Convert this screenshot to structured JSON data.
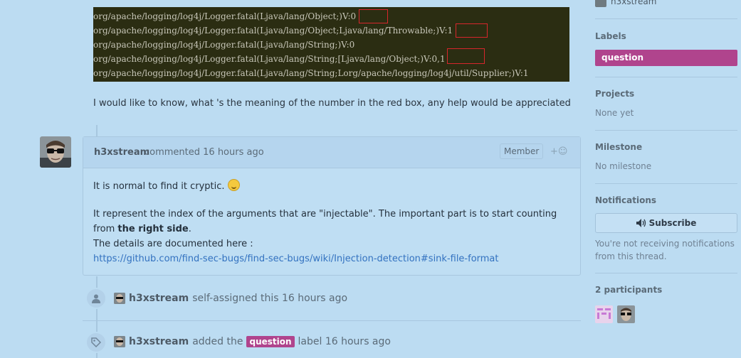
{
  "code": {
    "lines": [
      "org/apache/logging/log4j/Logger.fatal(Ljava/lang/Object;)V:0",
      "org/apache/logging/log4j/Logger.fatal(Ljava/lang/Object;Ljava/lang/Throwable;)V:1",
      "org/apache/logging/log4j/Logger.fatal(Ljava/lang/String;)V:0",
      "org/apache/logging/log4j/Logger.fatal(Ljava/lang/String;[Ljava/lang/Object;)V:0,1",
      "org/apache/logging/log4j/Logger.fatal(Ljava/lang/String;Lorg/apache/logging/log4j/util/Supplier;)V:1"
    ]
  },
  "question_text": "I would like to know, what 's the meaning of the number in the red box, any help would be appreciated",
  "comment": {
    "author": "h3xstream",
    "meta": "commented 16 hours ago",
    "badge": "Member",
    "reaction": "+☺",
    "p1": "It is normal to find it cryptic.",
    "p2_before": "It represent the index of the arguments that are \"injectable\". The important part is to start counting from ",
    "p2_bold": "the right side",
    "p2_after": ".",
    "p3": "The details are documented here :",
    "link": "https://github.com/find-sec-bugs/find-sec-bugs/wiki/Injection-detection#sink-file-format"
  },
  "events": {
    "assigned": {
      "author": "h3xstream",
      "text": "self-assigned this 16 hours ago"
    },
    "labeled": {
      "author": "h3xstream",
      "text_before": "added the",
      "label": "question",
      "text_after": "label 16 hours ago"
    }
  },
  "sidebar": {
    "top_user": "h3xstream",
    "labels_title": "Labels",
    "label": "question",
    "projects_title": "Projects",
    "projects_value": "None yet",
    "milestone_title": "Milestone",
    "milestone_value": "No milestone",
    "notifications_title": "Notifications",
    "subscribe": "Subscribe",
    "notifications_note": "You're not receiving notifications from this thread.",
    "participants_title": "2 participants"
  },
  "colors": {
    "label": "#b0448d",
    "link": "#3372c0",
    "redbox": "#d7262c"
  }
}
